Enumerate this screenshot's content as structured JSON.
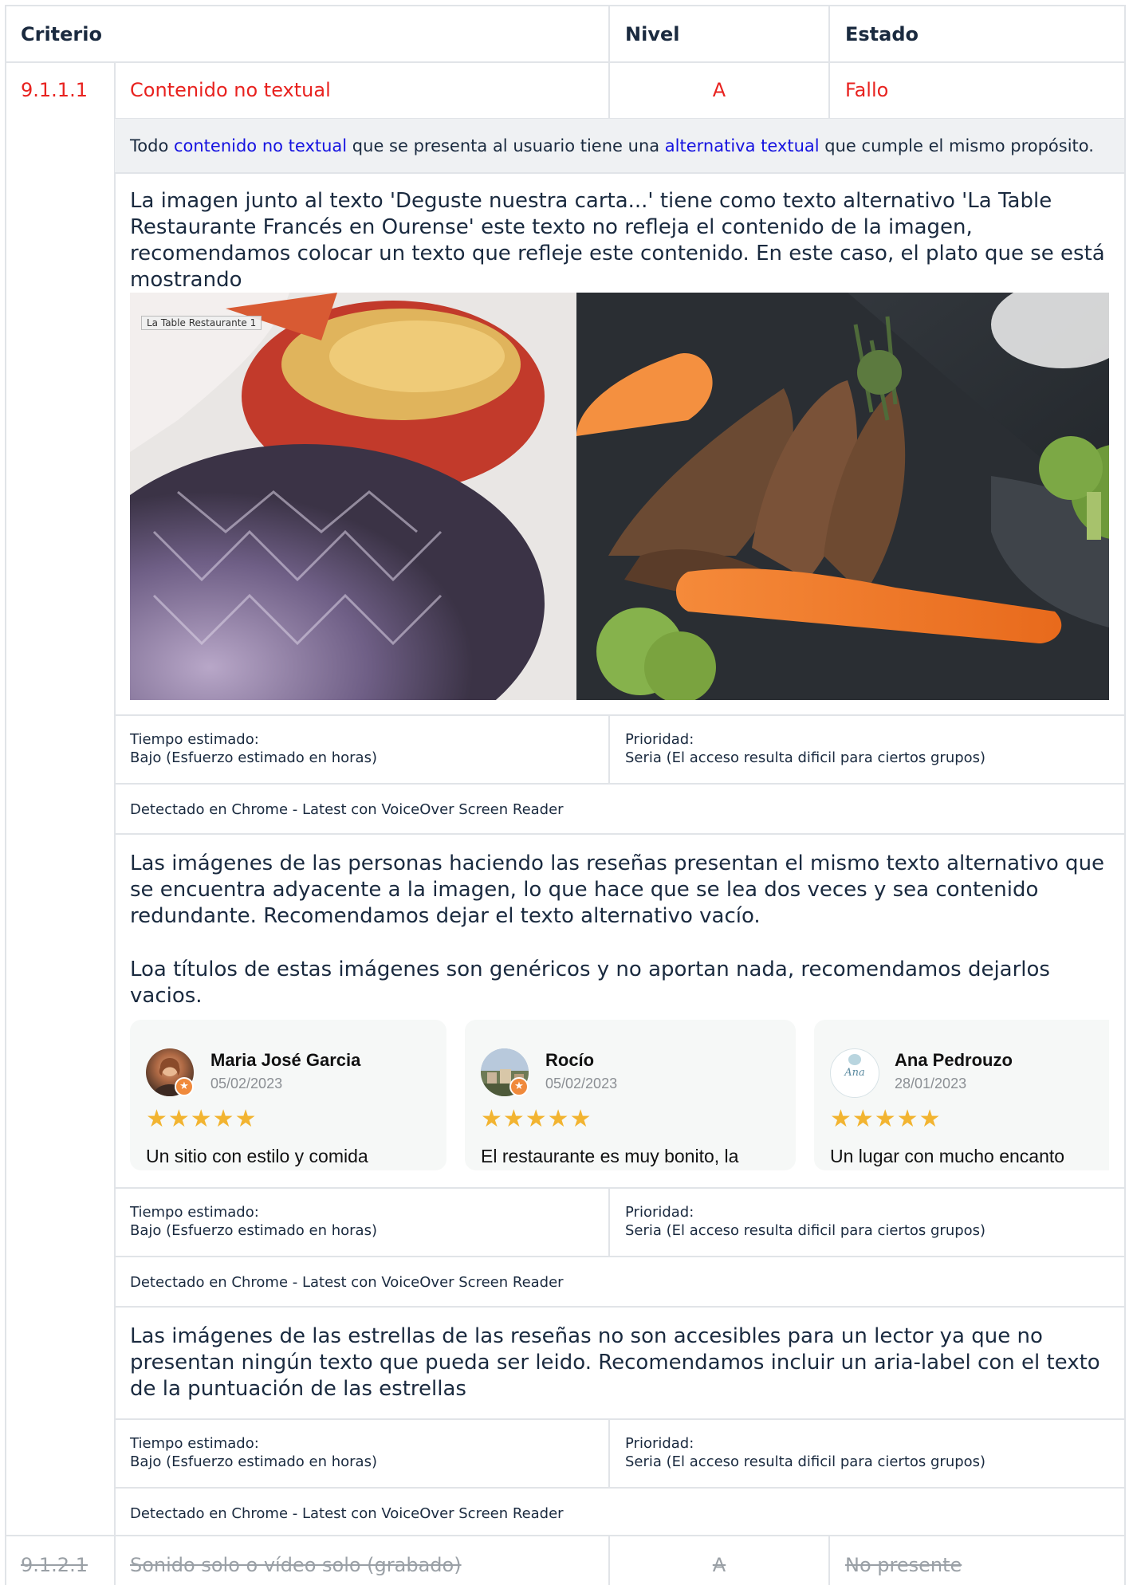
{
  "header": {
    "criterio": "Criterio",
    "nivel": "Nivel",
    "estado": "Estado"
  },
  "criterion1": {
    "id": "9.1.1.1",
    "name": "Contenido no textual",
    "level": "A",
    "status": "Fallo",
    "description": {
      "pre": "Todo ",
      "link1": "contenido no textual",
      "mid": " que se presenta al usuario tiene una ",
      "link2": "alternativa textual",
      "post": " que cumple el mismo propósito."
    },
    "colors": {
      "fail": "#e8221f",
      "link": "#1512e0",
      "stars": "#f2b431"
    }
  },
  "issue1": {
    "text": "La imagen junto al texto 'Deguste nuestra carta...' tiene como texto alternativo 'La Table Restaurante Francés en Ourense' este texto no refleja el contenido de la imagen, recomendamos colocar un texto que refleje este contenido. En este caso, el plato que se está mostrando",
    "image_label": "La Table Restaurante 1",
    "time_label": "Tiempo estimado:",
    "time_value": "Bajo (Esfuerzo estimado en horas)",
    "priority_label": "Prioridad:",
    "priority_value": "Seria (El acceso resulta dificil para ciertos grupos)",
    "detected": "Detectado en Chrome - Latest con VoiceOver Screen Reader"
  },
  "issue2": {
    "text1": "Las imágenes de las personas haciendo las reseñas presentan el mismo texto alternativo que se encuentra adyacente a la imagen, lo que hace que se lea dos veces y sea contenido redundante. Recomendamos dejar el texto alternativo vacío.",
    "text2": "Loa títulos de estas imágenes son genéricos y no aportan nada, recomendamos dejarlos vacios.",
    "reviews": [
      {
        "name": "Maria José Garcia",
        "date": "05/02/2023",
        "stars": "★★★★★",
        "text": "Un sitio con estilo y comida",
        "avatar_icon": "woman-portrait-icon"
      },
      {
        "name": "Rocío",
        "date": "05/02/2023",
        "stars": "★★★★★",
        "text": "El restaurante es muy bonito, la",
        "avatar_icon": "town-landscape-icon"
      },
      {
        "name": "Ana Pedrouzo",
        "date": "28/01/2023",
        "stars": "★★★★★",
        "text": "Un lugar con mucho encanto",
        "avatar_icon": "ana-pedrouzo-logo",
        "avatar_text": "Ana"
      }
    ],
    "time_label": "Tiempo estimado:",
    "time_value": "Bajo (Esfuerzo estimado en horas)",
    "priority_label": "Prioridad:",
    "priority_value": "Seria (El acceso resulta dificil para ciertos grupos)",
    "detected": "Detectado en Chrome - Latest con VoiceOver Screen Reader"
  },
  "issue3": {
    "text": "Las imágenes de las estrellas de las reseñas no son accesibles para un lector ya que no presentan ningún texto que pueda ser leido. Recomendamos incluir un aria-label con el texto de la puntuación de las estrellas",
    "time_label": "Tiempo estimado:",
    "time_value": "Bajo (Esfuerzo estimado en horas)",
    "priority_label": "Prioridad:",
    "priority_value": "Seria (El acceso resulta dificil para ciertos grupos)",
    "detected": "Detectado en Chrome - Latest con VoiceOver Screen Reader"
  },
  "criterion2": {
    "id": "9.1.2.1",
    "name": "Sonido solo o vídeo solo (grabado)",
    "level": "A",
    "status": "No presente"
  }
}
